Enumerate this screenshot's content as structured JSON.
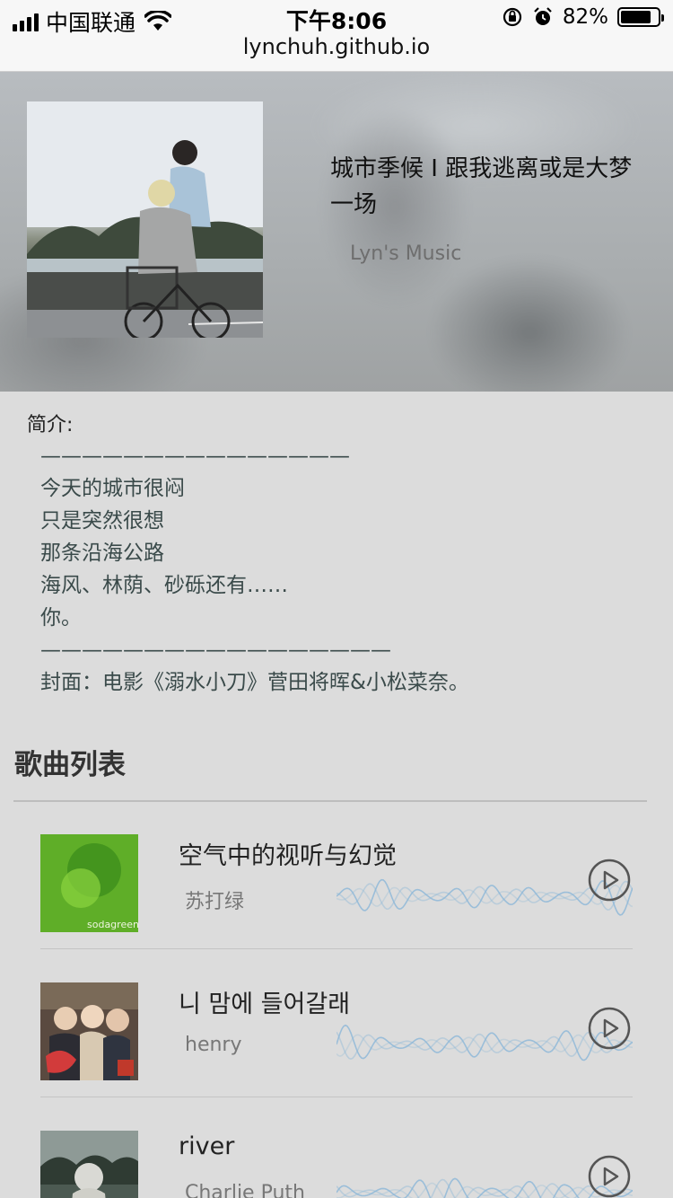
{
  "status_bar": {
    "carrier": "中国联通",
    "time": "下午8:06",
    "battery": "82%",
    "battery_level": 0.82,
    "url": "lynchuh.github.io",
    "icons": [
      "signal-icon",
      "wifi-icon",
      "rotation-lock-icon",
      "alarm-icon",
      "battery-icon"
    ]
  },
  "album": {
    "title": "城市季候 I 跟我逃离或是大梦一场",
    "author": "Lyn's Music"
  },
  "intro": {
    "label": "简介:",
    "lines": [
      "———————————————",
      "今天的城市很闷",
      "只是突然很想",
      "那条沿海公路",
      "海风、林荫、砂砾还有……",
      "你。",
      "—————————————————",
      "封面：电影《溺水小刀》菅田将晖&小松菜奈。"
    ]
  },
  "song_list": {
    "title": "歌曲列表",
    "songs": [
      {
        "name": "空气中的视听与幻觉",
        "artist": "苏打绿",
        "cover_text": "sodagreen"
      },
      {
        "name": "니 맘에 들어갈래",
        "artist": "henry"
      },
      {
        "name": "river",
        "artist": "Charlie Puth"
      }
    ]
  },
  "colors": {
    "page_bg": "#dcdcdc",
    "wave": "#8fb8d8",
    "play_icon": "#555555"
  }
}
